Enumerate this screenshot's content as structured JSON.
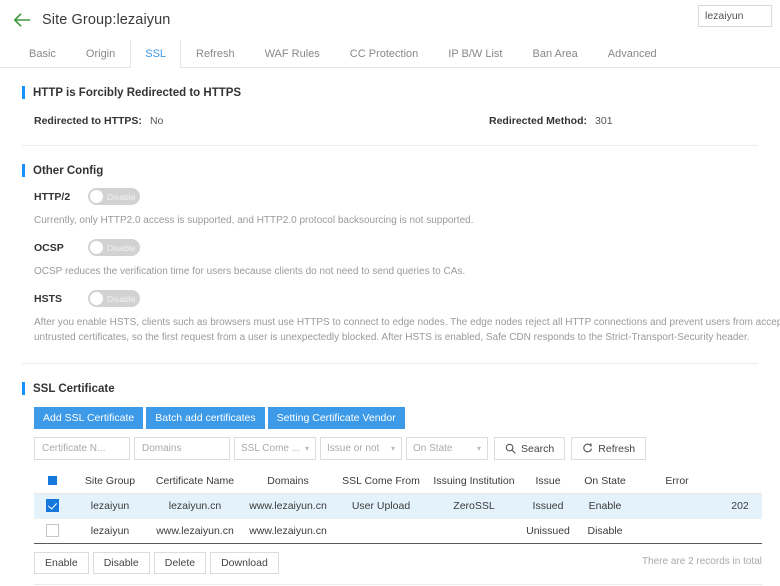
{
  "header": {
    "back_icon": "arrow-left-icon",
    "title": "Site Group:lezaiyun",
    "search_value": "lezaiyun"
  },
  "tabs": [
    {
      "label": "Basic",
      "active": false
    },
    {
      "label": "Origin",
      "active": false
    },
    {
      "label": "SSL",
      "active": true
    },
    {
      "label": "Refresh",
      "active": false
    },
    {
      "label": "WAF Rules",
      "active": false
    },
    {
      "label": "CC Protection",
      "active": false
    },
    {
      "label": "IP B/W List",
      "active": false
    },
    {
      "label": "Ban Area",
      "active": false
    },
    {
      "label": "Advanced",
      "active": false
    }
  ],
  "redirect_section": {
    "title": "HTTP is Forcibly Redirected to HTTPS",
    "fields": [
      {
        "label": "Redirected to HTTPS:",
        "value": "No"
      },
      {
        "label": "Redirected Method:",
        "value": "301"
      }
    ]
  },
  "other_config": {
    "title": "Other Config",
    "items": [
      {
        "label": "HTTP/2",
        "toggle_text": "Disable",
        "toggle_on": false,
        "description": "Currently, only HTTP2.0 access is supported, and HTTP2.0 protocol backsourcing is not supported."
      },
      {
        "label": "OCSP",
        "toggle_text": "Disable",
        "toggle_on": false,
        "description": "OCSP reduces the verification time for users because clients do not need to send queries to CAs."
      },
      {
        "label": "HSTS",
        "toggle_text": "Disable",
        "toggle_on": false,
        "description": "After you enable HSTS, clients such as browsers must use HTTPS to connect to edge nodes. The edge nodes reject all HTTP connections and prevent users from accepting untrusted certificates, so the first request from a user is unexpectedly blocked. After HSTS is enabled, Safe CDN responds to the Strict-Transport-Security header."
      }
    ]
  },
  "ssl_certificate": {
    "title": "SSL Certificate",
    "action_buttons": [
      {
        "label": "Add SSL Certificate"
      },
      {
        "label": "Batch add certificates"
      },
      {
        "label": "Setting Certificate Vendor"
      }
    ],
    "filters": {
      "certificate_name_placeholder": "Certificate N...",
      "domains_placeholder": "Domains",
      "ssl_come_from_label": "SSL Come ...",
      "issue_or_not_label": "Issue or not",
      "on_state_label": "On State",
      "search_label": "Search",
      "refresh_label": "Refresh"
    },
    "table": {
      "columns": [
        "Site Group",
        "Certificate Name",
        "Domains",
        "SSL Come From",
        "Issuing Institution",
        "Issue",
        "On State",
        "Error"
      ],
      "rows": [
        {
          "checked": true,
          "site_group": "lezaiyun",
          "certificate_name": "lezaiyun.cn",
          "domains": "www.lezaiyun.cn",
          "ssl_come_from": "User Upload",
          "issuing_institution": "ZeroSSL",
          "issue": "Issued",
          "on_state": "Enable",
          "error": "",
          "time": "202"
        },
        {
          "checked": false,
          "site_group": "lezaiyun",
          "certificate_name": "www.lezaiyun.cn",
          "domains": "www.lezaiyun.cn",
          "ssl_come_from": "",
          "issuing_institution": "",
          "issue": "Unissued",
          "on_state": "Disable",
          "error": "",
          "time": ""
        }
      ]
    },
    "bottom_buttons": [
      {
        "label": "Enable"
      },
      {
        "label": "Disable"
      },
      {
        "label": "Delete"
      },
      {
        "label": "Download"
      }
    ],
    "records_total": "There are 2 records in total"
  },
  "colors": {
    "accent_blue": "#3c9ae8",
    "section_bar_blue": "#1890ff",
    "success_green": "#29a745",
    "back_arrow_green": "#3d9a3d",
    "row_selected_bg": "#e3f2fb",
    "checkbox_blue": "#1677dd"
  }
}
